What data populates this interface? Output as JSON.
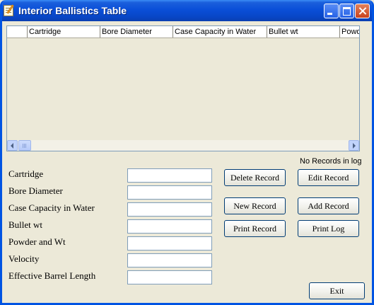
{
  "window": {
    "title": "Interior Ballistics Table"
  },
  "list": {
    "columns": [
      "",
      "Cartridge",
      "Bore Diameter",
      "Case Capacity in Water",
      "Bullet wt",
      "Powd"
    ],
    "rows": []
  },
  "status_text": "No Records in log",
  "form": {
    "fields": [
      {
        "label": "Cartridge",
        "value": ""
      },
      {
        "label": "Bore Diameter",
        "value": ""
      },
      {
        "label": "Case Capacity in Water",
        "value": ""
      },
      {
        "label": "Bullet wt",
        "value": ""
      },
      {
        "label": "Powder and Wt",
        "value": ""
      },
      {
        "label": "Velocity",
        "value": ""
      },
      {
        "label": "Effective Barrel Length",
        "value": ""
      }
    ]
  },
  "buttons": {
    "delete_record": "Delete Record",
    "edit_record": "Edit Record",
    "new_record": "New Record",
    "add_record": "Add Record",
    "print_record": "Print Record",
    "print_log": "Print Log",
    "exit": "Exit"
  },
  "icons": {
    "app": "notepad-pencil-icon",
    "minimize": "minimize-icon",
    "maximize": "maximize-icon",
    "close": "close-icon"
  }
}
